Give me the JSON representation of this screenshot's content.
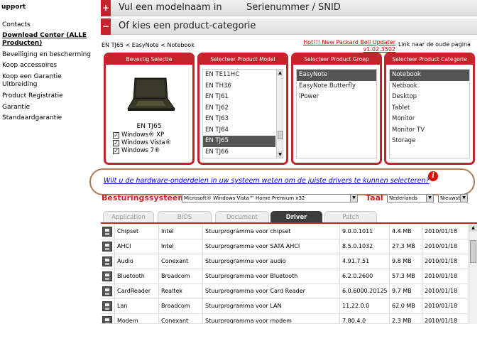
{
  "sidebar": {
    "title": "upport",
    "items": [
      "Contacts",
      "Download Center (ALLE Producten)",
      "Beveiliging en bescherming",
      "Koop accessoires",
      "Koop een Garantie Uitbreiding",
      "Product Registratie",
      "Garantie",
      "Standaardgarantie"
    ]
  },
  "accordion": {
    "bar1_label": "Vul een modelnaam in",
    "bar1_label2": "Serienummer / SNID",
    "bar1_sign": "+",
    "bar2_label": "Of kies een product-categorie",
    "bar2_sign": "−"
  },
  "breadcrumb": "EN TJ65 < EasyNote < Notebook",
  "hot_link": "Hot!!! New Packard Bell Updater v1.02.3502",
  "old_page_text": "Link naar de oude pagina",
  "boxes": {
    "confirm": {
      "title": "Bevestig Selectie",
      "model": "EN TJ65",
      "os": [
        "Windows® XP",
        "Windows Vista®",
        "Windows 7®"
      ]
    },
    "model": {
      "title": "Selecteer Product Model",
      "items": [
        "EN TE11HC",
        "EN TH36",
        "EN TJ61",
        "EN TJ62",
        "EN TJ63",
        "EN TJ64",
        "EN TJ65",
        "EN TJ66"
      ],
      "selected": "EN TJ65"
    },
    "group": {
      "title": "Selecteer Product Groep",
      "items": [
        "EasyNote",
        "EasyNote Butterfly",
        "iPower"
      ],
      "selected": "EasyNote"
    },
    "category": {
      "title": "Selecteer Product Categorie",
      "items": [
        "Notebook",
        "Netbook",
        "Desktop",
        "Tablet",
        "Monitor",
        "Monitor TV",
        "Storage"
      ],
      "selected": "Notebook"
    }
  },
  "hardware_link": "Wilt u de hardware-onderdelen in uw systeem weten om de juiste drivers te kunnen selecteren?",
  "info_glyph": "i",
  "os_label": "Besturingssysteem",
  "os_value": "Microsoft® Windows Vista™ Home Premium x32",
  "lang_label": "Taal",
  "lang_value": "Nederlands",
  "newest_value": "Nieuwste",
  "tabs": [
    "Application",
    "BIOS",
    "Document",
    "Driver",
    "Patch"
  ],
  "active_tab": "Driver",
  "drivers": [
    {
      "name": "Chipset",
      "vendor": "Intel",
      "desc": "Stuurprogramma voor chipset",
      "version": "9.0.0.1011",
      "size": "4.4 MB",
      "date": "2010/01/18"
    },
    {
      "name": "AHCI",
      "vendor": "Intel",
      "desc": "Stuurprogramma voor SATA AHCI",
      "version": "8.5.0.1032",
      "size": "27.3 MB",
      "date": "2010/01/18"
    },
    {
      "name": "Audio",
      "vendor": "Conexant",
      "desc": "Stuurprogramma voor audio",
      "version": "4.91.7.51",
      "size": "9.8 MB",
      "date": "2010/01/18"
    },
    {
      "name": "Bluetooth",
      "vendor": "Broadcom",
      "desc": "Stuurprogramma voor Bluetooth",
      "version": "6.2.0.2600",
      "size": "57.3 MB",
      "date": "2010/01/18"
    },
    {
      "name": "CardReader",
      "vendor": "Realtek",
      "desc": "Stuurprogramma voor Card Reader",
      "version": "6.0.6000.20125",
      "size": "9.7 MB",
      "date": "2010/01/18"
    },
    {
      "name": "Lan",
      "vendor": "Broadcom",
      "desc": "Stuurprogramma voor LAN",
      "version": "11.22.0.0",
      "size": "62.0 MB",
      "date": "2010/01/18"
    },
    {
      "name": "Modem",
      "vendor": "Conexant",
      "desc": "Stuurprogramma voor modem",
      "version": "7.80.4.0",
      "size": "2.3 MB",
      "date": "2010/01/18"
    }
  ],
  "colors": {
    "brand_red": "#c5232b",
    "selected_bg": "#555555",
    "link": "#0000ee"
  }
}
